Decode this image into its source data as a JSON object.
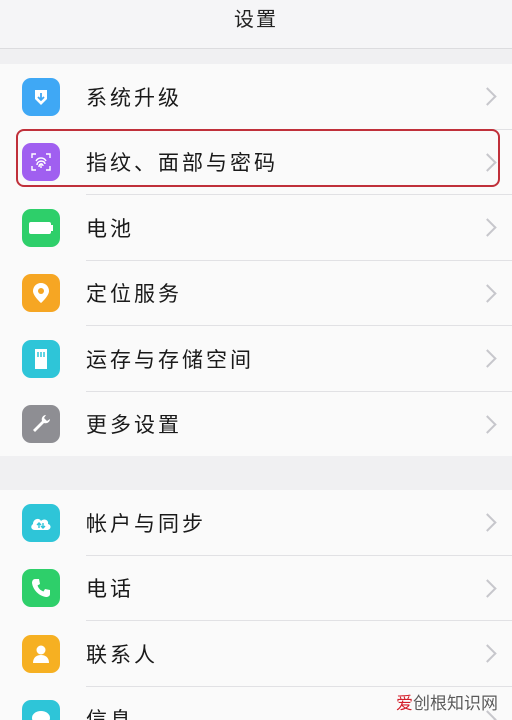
{
  "header": {
    "title": "设置"
  },
  "group1": [
    {
      "label": "系统升级",
      "icon": "system-update-icon",
      "color": "#3fa8f5"
    },
    {
      "label": "指纹、面部与密码",
      "icon": "fingerprint-icon",
      "color": "#a05ff0"
    },
    {
      "label": "电池",
      "icon": "battery-icon",
      "color": "#2ecf6a"
    },
    {
      "label": "定位服务",
      "icon": "location-pin-icon",
      "color": "#f6a623"
    },
    {
      "label": "运存与存储空间",
      "icon": "storage-card-icon",
      "color": "#2ec5d8"
    },
    {
      "label": "更多设置",
      "icon": "wrench-icon",
      "color": "#8e8e93"
    }
  ],
  "group2": [
    {
      "label": "帐户与同步",
      "icon": "cloud-sync-icon",
      "color": "#2ec5d8"
    },
    {
      "label": "电话",
      "icon": "phone-icon",
      "color": "#2ecf6a"
    },
    {
      "label": "联系人",
      "icon": "contact-person-icon",
      "color": "#f6b022"
    },
    {
      "label": "信息",
      "icon": "message-icon",
      "color": "#2ec5d8"
    }
  ],
  "watermark": {
    "prefix": "爱",
    "rest": "创根知识网"
  },
  "colors": {
    "highlight": "#c0303a",
    "background": "#f0f0f2"
  }
}
